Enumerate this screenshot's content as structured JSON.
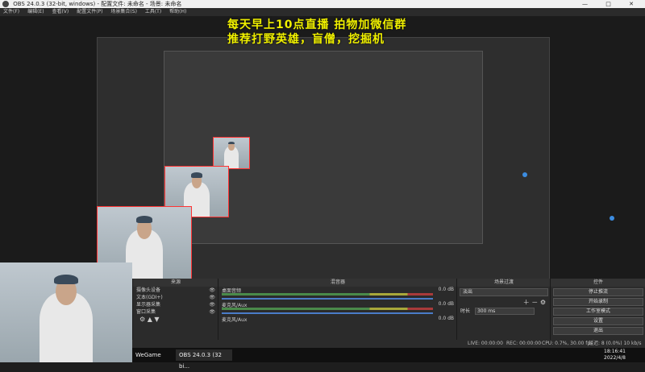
{
  "window": {
    "title": "OBS 24.0.3 (32-bit, windows) - 配置文件: 未命名 - 场景: 未命名",
    "controls": [
      "—",
      "□",
      "✕"
    ]
  },
  "menu": [
    "文件(F)",
    "编辑(E)",
    "查看(V)",
    "配置文件(P)",
    "场景集合(S)",
    "工具(T)",
    "帮助(H)"
  ],
  "overlay": {
    "line1": "每天早上10点直播    拍物加微信群",
    "line2": "推荐打野英雄，盲僧，挖掘机"
  },
  "panels": {
    "sources_title": "来源",
    "mixer_title": "混音器",
    "transitions_title": "场景过渡",
    "controls_title": "控件"
  },
  "sources": [
    {
      "name": "摄像头设备"
    },
    {
      "name": "文本(GDI+)"
    },
    {
      "name": "显示器采集"
    },
    {
      "name": "窗口采集"
    }
  ],
  "mixer": [
    {
      "name": "桌面音频",
      "level": "0.0 dB"
    },
    {
      "name": "麦克风/Aux",
      "level": "0.0 dB"
    },
    {
      "name": "麦克风/Aux",
      "level": "0.0 dB"
    }
  ],
  "transitions": {
    "type": "淡出",
    "duration_label": "时长",
    "duration_value": "300 ms"
  },
  "controls": [
    "停止推流",
    "开始录制",
    "工作室模式",
    "设置",
    "退出"
  ],
  "status": {
    "live": "LIVE: 00:00:00",
    "rec": "REC: 00:00:00",
    "cpu": "CPU: 0.7%, 30.00 fps",
    "stats": "延迟: 8 (0.0%)  10 kb/s"
  },
  "taskbar": {
    "app1": "WeGame",
    "app2": "OBS 24.0.3 (32 bi...",
    "time": "18:16:41",
    "date": "2022/4/8"
  }
}
